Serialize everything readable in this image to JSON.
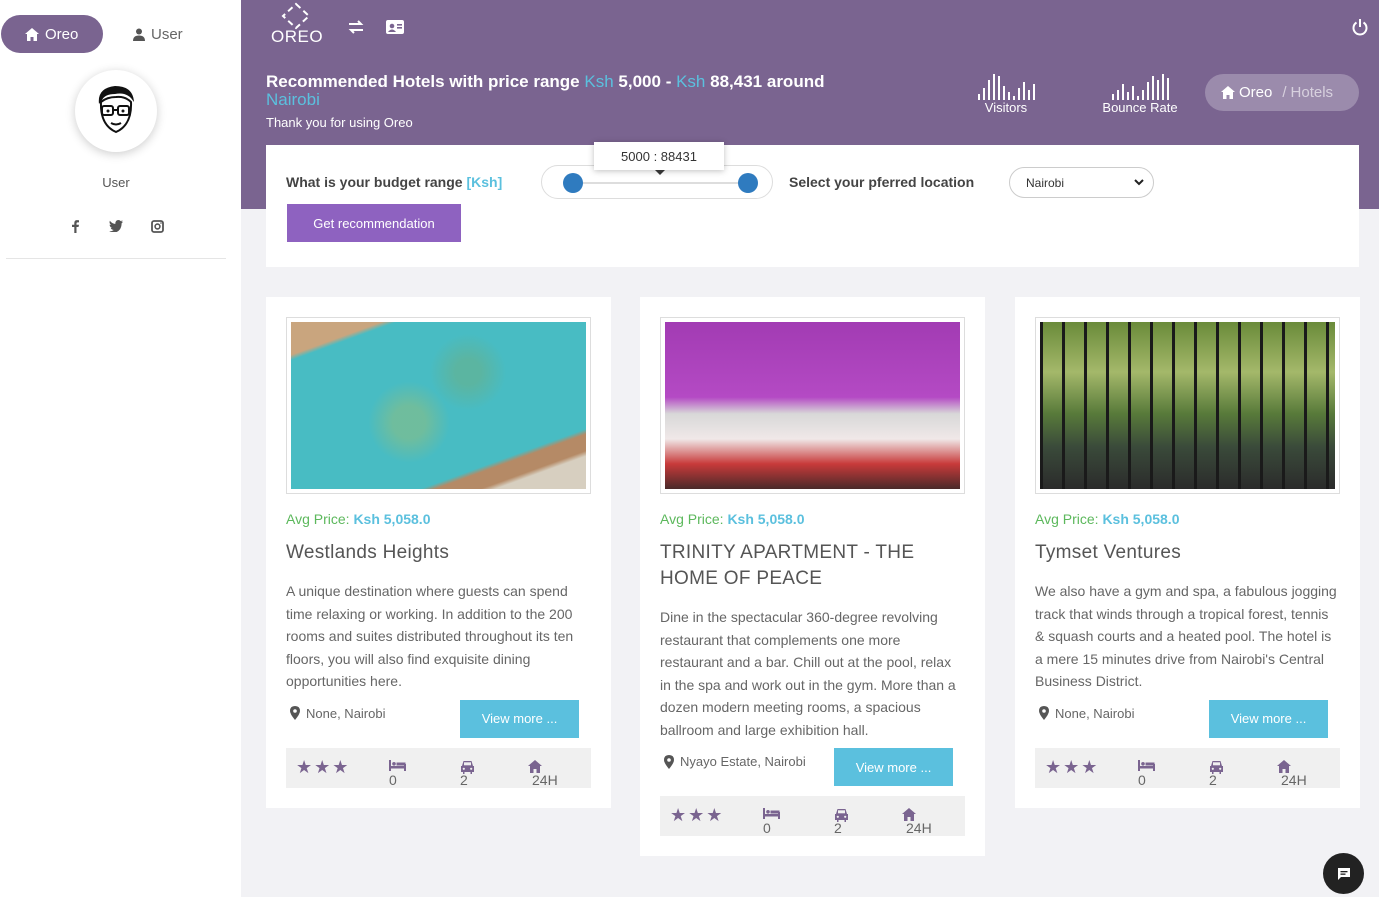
{
  "sidebar": {
    "tabs": [
      {
        "label": "Oreo",
        "icon": "home-icon"
      },
      {
        "label": "User",
        "icon": "user-icon"
      }
    ],
    "user_name": "User",
    "socials": [
      "facebook-icon",
      "twitter-icon",
      "instagram-icon"
    ]
  },
  "header": {
    "brand": "OREO",
    "title_prefix": "Recommended Hotels with price range",
    "currency": "Ksh",
    "min_price": "5,000",
    "dash": "-",
    "max_price": "88,431",
    "around": "around",
    "location": "Nairobi",
    "thanks": "Thank you for using Oreo",
    "stats": [
      {
        "label": "Visitors"
      },
      {
        "label": "Bounce Rate"
      }
    ],
    "breadcrumb": {
      "home": "Oreo",
      "current": "Hotels"
    }
  },
  "filter": {
    "budget_label": "What is your budget range",
    "budget_unit": "[Ksh]",
    "slider_value": "5000 : 88431",
    "location_label": "Select your pferred location",
    "location_selected": "Nairobi",
    "button": "Get recommendation"
  },
  "hotels": [
    {
      "avg_label": "Avg Price:",
      "price": "Ksh 5,058.0",
      "name": "Westlands Heights",
      "desc": "A unique destination where guests can spend time relaxing or working. In addition to the 200 rooms and suites distributed throughout its ten floors, you will also find exquisite dining opportunities here.",
      "location": "None, Nairobi",
      "button": "View more ...",
      "stars": "★★★",
      "rooms": "0",
      "cars": "2",
      "hours": "24H"
    },
    {
      "avg_label": "Avg Price:",
      "price": "Ksh 5,058.0",
      "name": "TRINITY APARTMENT - THE HOME OF PEACE",
      "desc": "Dine in the spectacular 360-degree revolving restaurant that complements one more restaurant and a bar. Chill out at the pool, relax in the spa and work out in the gym. More than a dozen modern meeting rooms, a spacious ballroom and large exhibition hall.",
      "location": "Nyayo Estate, Nairobi",
      "button": "View more ...",
      "stars": "★★★",
      "rooms": "0",
      "cars": "2",
      "hours": "24H"
    },
    {
      "avg_label": "Avg Price:",
      "price": "Ksh 5,058.0",
      "name": "Tymset Ventures",
      "desc": "We also have a gym and spa, a fabulous jogging track that winds through a tropical forest, tennis & squash courts and a heated pool. The hotel is a mere 15 minutes drive from Nairobi's Central Business District.",
      "location": "None, Nairobi",
      "button": "View more ...",
      "stars": "★★★",
      "rooms": "0",
      "cars": "2",
      "hours": "24H"
    }
  ],
  "colors": {
    "brand": "#7a6490",
    "accent": "#5bc0de",
    "button": "#8e62c0",
    "green": "#5cb85c"
  }
}
